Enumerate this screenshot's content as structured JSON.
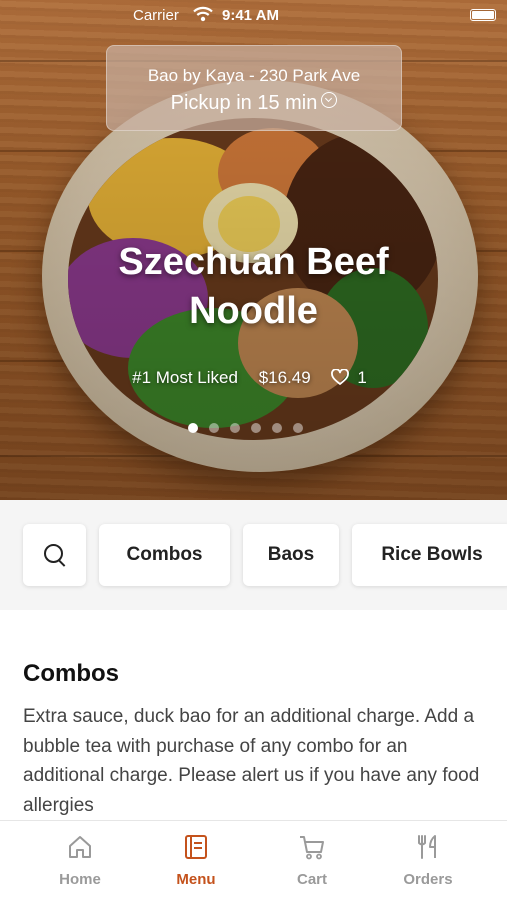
{
  "status_bar": {
    "carrier": "Carrier",
    "time": "9:41 AM"
  },
  "location": {
    "name": "Bao by Kaya - 230 Park Ave",
    "pickup": "Pickup in 15 min"
  },
  "featured": {
    "title": "Szechuan Beef Noodle",
    "badge": "#1 Most Liked",
    "price": "$16.49",
    "likes": "1",
    "slide_count": 6,
    "active_slide": 0
  },
  "categories": {
    "search_icon": "search-icon",
    "items": [
      "Combos",
      "Baos",
      "Rice Bowls"
    ]
  },
  "section": {
    "title": "Combos",
    "description": "Extra sauce, duck bao for an additional charge. Add a bubble tea with purchase of any combo for an additional charge. Please alert us if you have any food allergies"
  },
  "tabbar": {
    "items": [
      {
        "label": "Home",
        "icon": "home-icon"
      },
      {
        "label": "Menu",
        "icon": "menu-icon"
      },
      {
        "label": "Cart",
        "icon": "cart-icon"
      },
      {
        "label": "Orders",
        "icon": "orders-icon"
      }
    ],
    "active": "Menu"
  },
  "colors": {
    "accent": "#c4521c",
    "inactive": "#9a9a9a"
  }
}
